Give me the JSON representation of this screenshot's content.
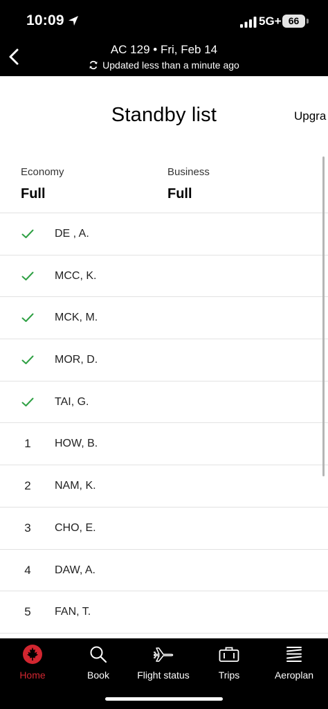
{
  "status_bar": {
    "time": "10:09",
    "network": "5G+",
    "battery": "66"
  },
  "header": {
    "flight": "AC 129 • Fri, Feb 14",
    "updated": "Updated less than a minute ago"
  },
  "page": {
    "title": "Standby list",
    "next_tab": "Upgra"
  },
  "cabins": {
    "economy": {
      "label": "Economy",
      "status": "Full"
    },
    "business": {
      "label": "Business",
      "status": "Full"
    }
  },
  "standby": [
    {
      "mark": "check",
      "name": "DE , A."
    },
    {
      "mark": "check",
      "name": "MCC, K."
    },
    {
      "mark": "check",
      "name": "MCK, M."
    },
    {
      "mark": "check",
      "name": "MOR, D."
    },
    {
      "mark": "check",
      "name": "TAI, G."
    },
    {
      "mark": "1",
      "name": "HOW, B."
    },
    {
      "mark": "2",
      "name": "NAM, K."
    },
    {
      "mark": "3",
      "name": "CHO, E."
    },
    {
      "mark": "4",
      "name": "DAW, A."
    },
    {
      "mark": "5",
      "name": "FAN, T."
    }
  ],
  "tabs": [
    {
      "label": "Home",
      "icon": "maple-leaf-icon"
    },
    {
      "label": "Book",
      "icon": "search-icon"
    },
    {
      "label": "Flight status",
      "icon": "airplane-icon"
    },
    {
      "label": "Trips",
      "icon": "suitcase-icon"
    },
    {
      "label": "Aeroplan",
      "icon": "aeroplan-icon"
    }
  ],
  "colors": {
    "accent_red": "#d22630",
    "check_green": "#2ea043"
  }
}
